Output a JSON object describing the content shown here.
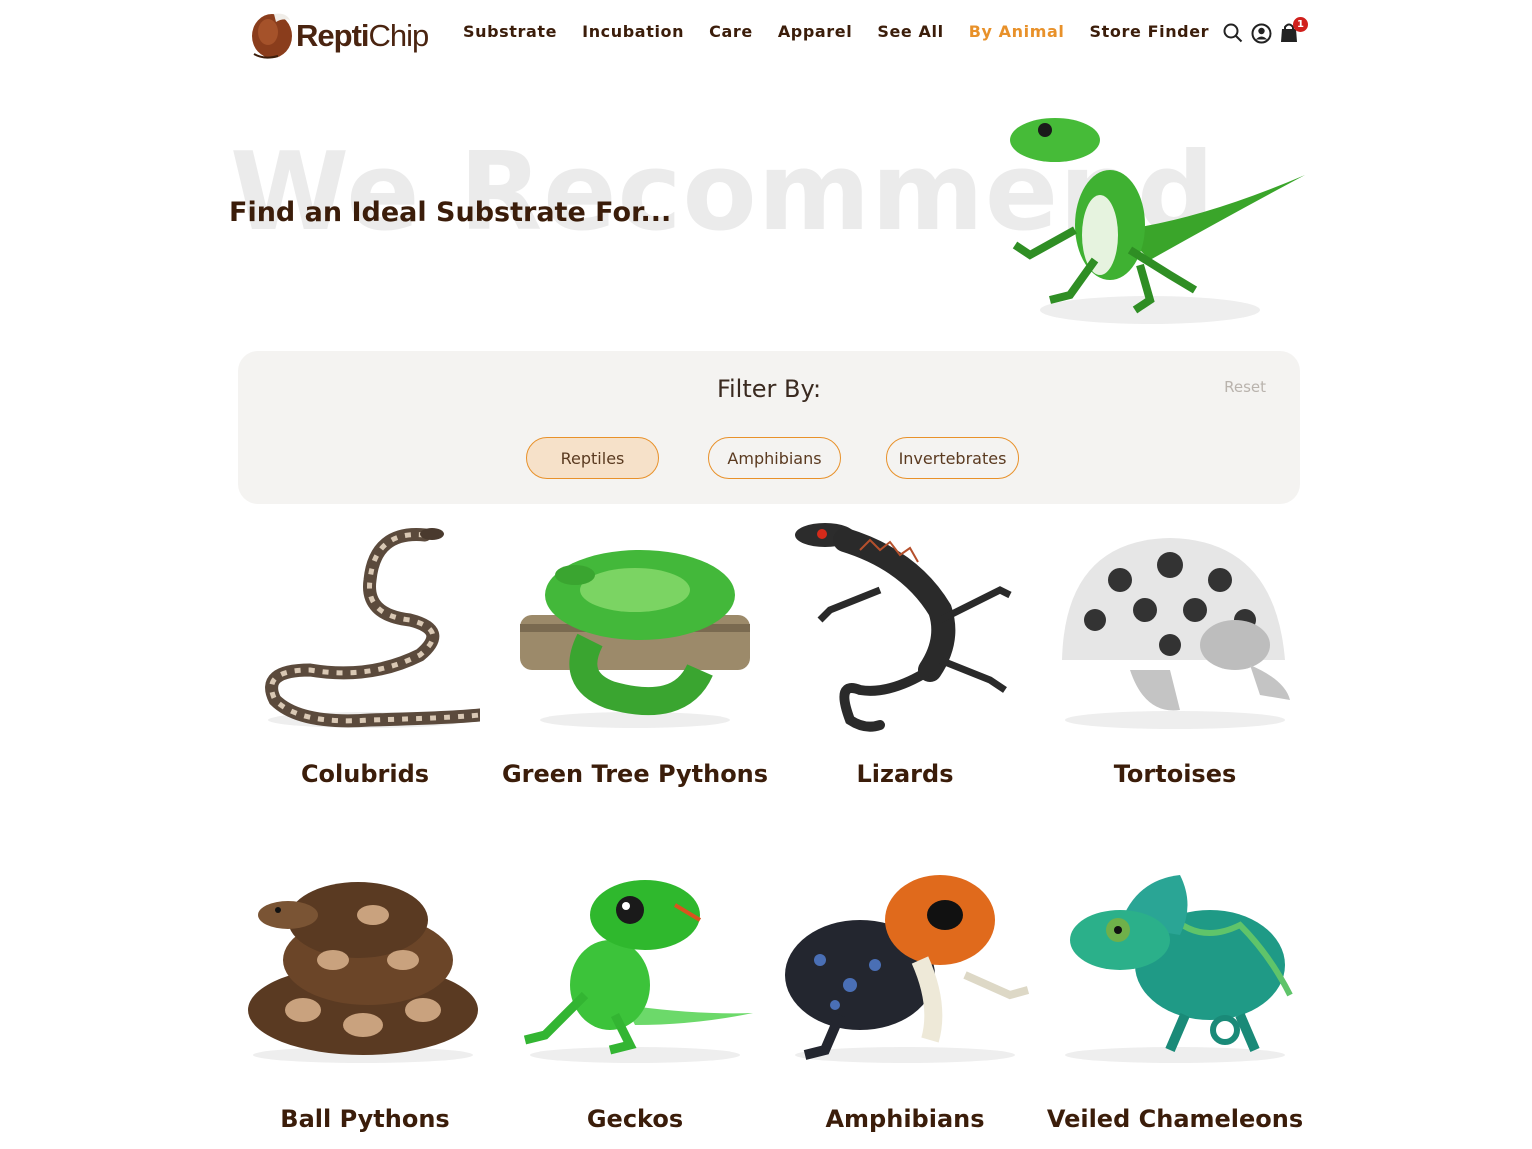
{
  "brand": {
    "name_bold": "Repti",
    "name_light": "Chip"
  },
  "nav": {
    "items": [
      {
        "label": "Substrate",
        "active": false
      },
      {
        "label": "Incubation",
        "active": false
      },
      {
        "label": "Care",
        "active": false
      },
      {
        "label": "Apparel",
        "active": false
      },
      {
        "label": "See All",
        "active": false
      },
      {
        "label": "By Animal",
        "active": true
      },
      {
        "label": "Store Finder",
        "active": false
      }
    ],
    "icons": [
      "search-icon",
      "account-icon",
      "cart-icon"
    ],
    "cart_count": "1"
  },
  "hero": {
    "watermark": "We Recommend",
    "title": "Find an Ideal Substrate For..."
  },
  "filter": {
    "title": "Filter By:",
    "reset_label": "Reset",
    "chips": [
      {
        "label": "Reptiles",
        "selected": true
      },
      {
        "label": "Amphibians",
        "selected": false
      },
      {
        "label": "Invertebrates",
        "selected": false
      }
    ]
  },
  "animals": [
    {
      "label": "Colubrids"
    },
    {
      "label": "Green Tree Pythons"
    },
    {
      "label": "Lizards"
    },
    {
      "label": "Tortoises"
    },
    {
      "label": "Ball Pythons"
    },
    {
      "label": "Geckos"
    },
    {
      "label": "Amphibians"
    },
    {
      "label": "Veiled Chameleons"
    }
  ],
  "colors": {
    "brand_brown": "#3b1d0a",
    "accent_orange": "#e8912a",
    "badge_red": "#d0201c",
    "filter_bg": "#f4f3f1",
    "chip_selected_bg": "#f6e1c9"
  }
}
